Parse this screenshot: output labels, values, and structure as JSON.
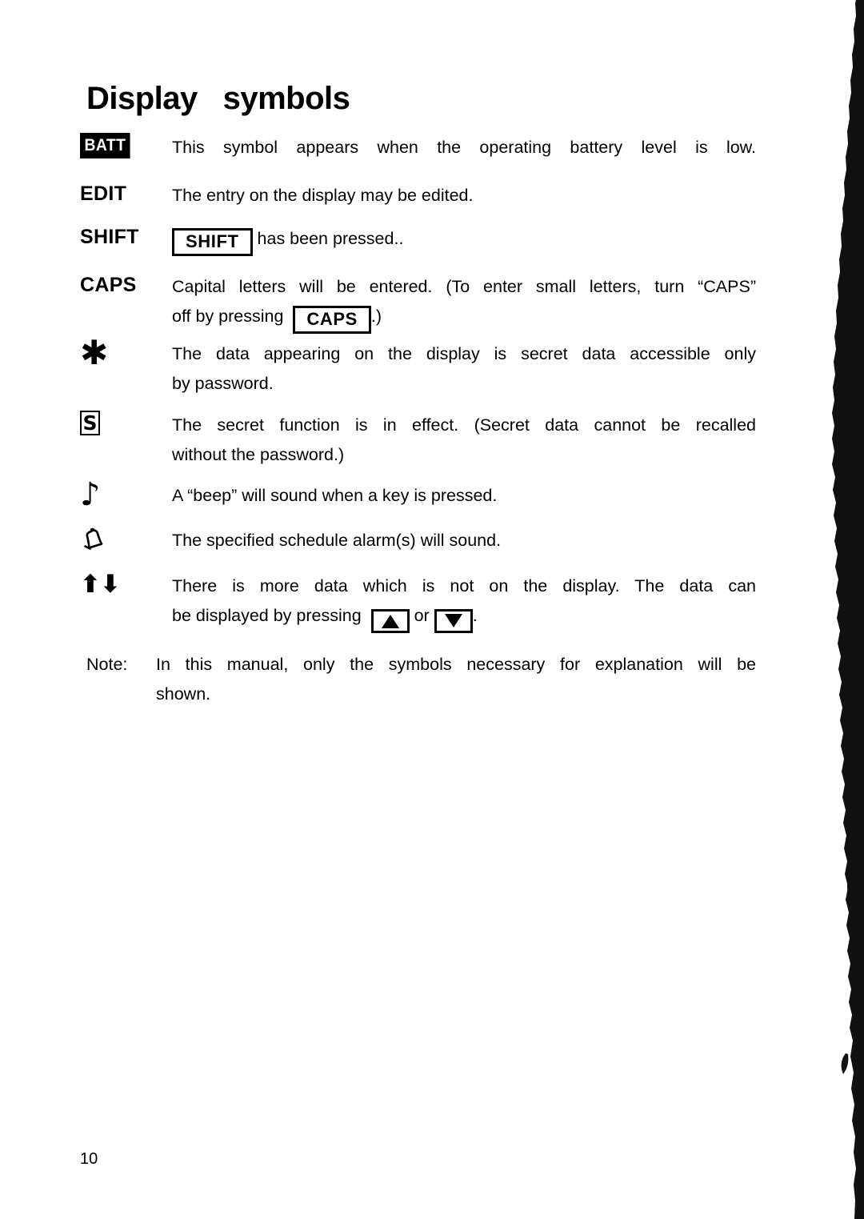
{
  "page": {
    "title": "Display   symbols",
    "number": "10",
    "note_label": "Note:",
    "note_text": "In this manual, only the symbols necessary for explanation will be shown.",
    "note_line1": "In  this  manual,  only  the  symbols  necessary  for  explanation  will  be",
    "note_line2": "shown."
  },
  "symbols": [
    {
      "id": "batt",
      "symbol_kind": "inverse-badge",
      "symbol_label": "BATT",
      "icon_name": "battery-low-indicator",
      "description": "This symbol appears when the operating battery level is low.",
      "lines": [
        "This  symbol  appears  when  the  operating  battery  level  is  low."
      ]
    },
    {
      "id": "edit",
      "symbol_kind": "text-label",
      "symbol_label": "EDIT",
      "icon_name": "edit-indicator",
      "description": "The entry on the display may be edited.",
      "lines": [
        "The  entry  on  the  display  may  be  edited."
      ]
    },
    {
      "id": "shift",
      "symbol_kind": "text-label",
      "symbol_label": "SHIFT",
      "icon_name": "shift-indicator",
      "keycap": "SHIFT",
      "description_after_key": "has  been  pressed..",
      "description": "SHIFT has been pressed.."
    },
    {
      "id": "caps",
      "symbol_kind": "text-label",
      "symbol_label": "CAPS",
      "icon_name": "caps-indicator",
      "keycap": "CAPS",
      "line1": "Capital  letters  will  be  entered.  (To  enter  small  letters,  turn  “CAPS”",
      "line2_before_key": "off  by  pressing",
      "line2_after_key": ".)",
      "description": "Capital letters will be entered. (To enter small letters, turn “CAPS” off by pressing CAPS .)"
    },
    {
      "id": "secret-data",
      "symbol_kind": "glyph",
      "symbol_label": "✳",
      "icon_name": "asterisk-icon",
      "description": "The data appearing on the display is secret data accessible only by password.",
      "lines": [
        "The  data  appearing  on  the  display  is  secret  data  accessible  only",
        "by   password."
      ]
    },
    {
      "id": "secret-function",
      "symbol_kind": "boxed-glyph",
      "symbol_label": "S",
      "icon_name": "boxed-s-icon",
      "description": "The secret function is in effect. (Secret data cannot be recalled without the password.)",
      "lines": [
        "The  secret  function  is  in  effect.  (Secret  data  cannot  be  recalled",
        "without   the   password.)"
      ]
    },
    {
      "id": "beep",
      "symbol_kind": "glyph",
      "symbol_label": "♪",
      "icon_name": "music-note-icon",
      "description": "A “beep” will sound when a key is pressed.",
      "lines": [
        "A  “beep”  will  sound  when  a  key  is  pressed."
      ]
    },
    {
      "id": "alarm",
      "symbol_kind": "glyph",
      "symbol_label": "♪",
      "icon_name": "bell-icon",
      "description": "The specified schedule alarm(s) will sound.",
      "lines": [
        "The   specified   schedule   alarm(s)   will   sound."
      ]
    },
    {
      "id": "more-data",
      "symbol_kind": "glyph",
      "symbol_label": "↑↓",
      "icon_name": "up-down-arrows-icon",
      "keycap_up": "▲",
      "keycap_down": "▼",
      "line1": "There  is  more  data  which  is  not  on  the  display.  The  data  can",
      "line2_before_key": "be  displayed  by  pressing",
      "line2_mid": "or",
      "line2_after_key": ".",
      "description": "There is more data which is not on the display. The data can be displayed by pressing ▲ or ▼ ."
    }
  ],
  "colors": {
    "ink": "#000000",
    "paper": "#ffffff"
  }
}
